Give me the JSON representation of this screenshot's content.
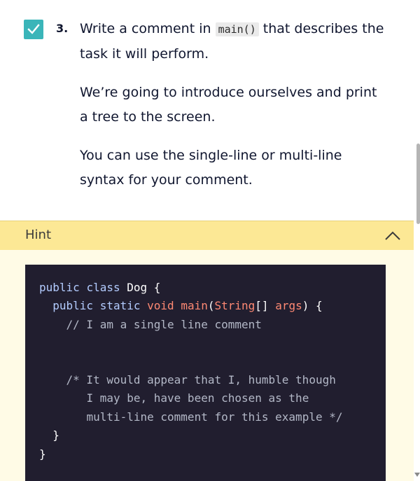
{
  "task": {
    "checked": true,
    "number": "3.",
    "title_before_code": "Write a comment in ",
    "title_code": "main()",
    "title_after_code": " that describes the task it will perform.",
    "paragraphs": [
      "We’re going to introduce ourselves and print a tree to the screen.",
      "You can use the single-line or multi-line syntax for your comment."
    ]
  },
  "hint": {
    "label": "Hint",
    "expanded": true,
    "code_lines": [
      "public class Dog {",
      "  public static void main(String[] args) {",
      "    // I am a single line comment",
      "",
      "",
      "    /* It would appear that I, humble though",
      "       I may be, have been chosen as the",
      "       multi-line comment for this example */",
      "  }",
      "}"
    ]
  },
  "icons": {
    "checkbox": "check-icon",
    "hint_toggle": "chevron-up-icon",
    "scroll_down": "scroll-down-arrow-icon"
  },
  "colors": {
    "checkbox": "#3ab5b9",
    "hint_header_bg": "#fce895",
    "hint_body_bg": "#fffbe6",
    "code_bg": "#211e2f",
    "code_keyword": "#b3ccff",
    "code_type": "#ff8973",
    "code_comment": "#b3b8c7"
  }
}
